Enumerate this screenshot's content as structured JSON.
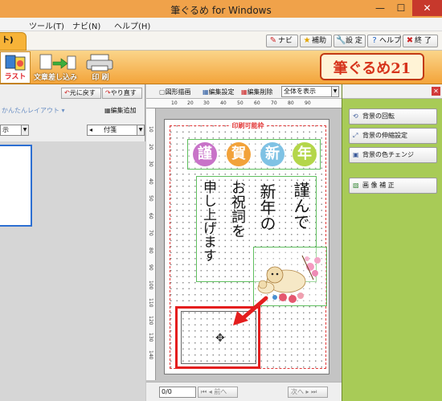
{
  "window": {
    "title": "筆ぐるめ for Windows",
    "minimize": "—",
    "maximize": "☐",
    "close": "✕"
  },
  "menu": [
    "ツール(T)",
    "ナビ(N)",
    "ヘルプ(H)"
  ],
  "tabbar": {
    "active_tab": "ト)",
    "buttons": [
      {
        "label": "ナビ",
        "icon": "magic-wand-icon"
      },
      {
        "label": "補助",
        "icon": "star-icon"
      },
      {
        "label": "設 定",
        "icon": "wrench-icon"
      },
      {
        "label": "ヘルプ",
        "icon": "question-icon"
      },
      {
        "label": "終 了",
        "icon": "exit-icon"
      }
    ]
  },
  "main_toolbar": {
    "buttons": [
      {
        "label": "ラスト",
        "selected": true
      },
      {
        "label": "文章差し込み",
        "selected": false
      },
      {
        "label": "印 刷",
        "selected": false
      }
    ],
    "logo": "筆ぐるめ21"
  },
  "left_panel": {
    "undo": "元に戻す",
    "redo": "やり直す",
    "easy_layout": "かんたんレイアウト",
    "add_frame": "編集追加",
    "view_select": "示",
    "sticky_select": "付箋"
  },
  "editor": {
    "toolbar": {
      "shape_draw": "図形描画",
      "frame_setting": "編集設定",
      "frame_delete": "編集削除",
      "zoom_select": "全体を表示"
    },
    "ruler_top": [
      "10",
      "20",
      "30",
      "40",
      "50",
      "60",
      "70",
      "80",
      "90"
    ],
    "ruler_left": [
      "10",
      "20",
      "30",
      "40",
      "50",
      "60",
      "70",
      "80",
      "90",
      "100",
      "110",
      "120",
      "130",
      "140"
    ],
    "print_area_label": "印刷可能枠",
    "new_year_chars": [
      "謹",
      "賀",
      "新",
      "年"
    ],
    "greeting_col1": "謹んで",
    "greeting_col2": "新年の",
    "greeting_col3": "お祝詞を",
    "greeting_col4": "申し上げます",
    "page_indicator": "0/0",
    "prev_page": "前へ",
    "next_page": "次へ"
  },
  "right_panel": {
    "buttons": [
      {
        "label": "背景の回転",
        "icon": "rotate-icon"
      },
      {
        "label": "背景の伸縮設定",
        "icon": "resize-icon"
      },
      {
        "label": "背景の色チェンジ",
        "icon": "color-change-icon"
      },
      {
        "label": "画 像 補 正",
        "icon": "image-adjust-icon"
      }
    ]
  },
  "colors": {
    "title_bar": "#f0a24a",
    "toolbar": "#f3a43a",
    "right_panel": "#a8cb57",
    "print_area": "#e23a3a",
    "selection_highlight": "#e41e1e",
    "circle_1": "#c873c8",
    "circle_2": "#f2a23a",
    "circle_3": "#7fc2e4",
    "circle_4": "#b4d64a"
  }
}
